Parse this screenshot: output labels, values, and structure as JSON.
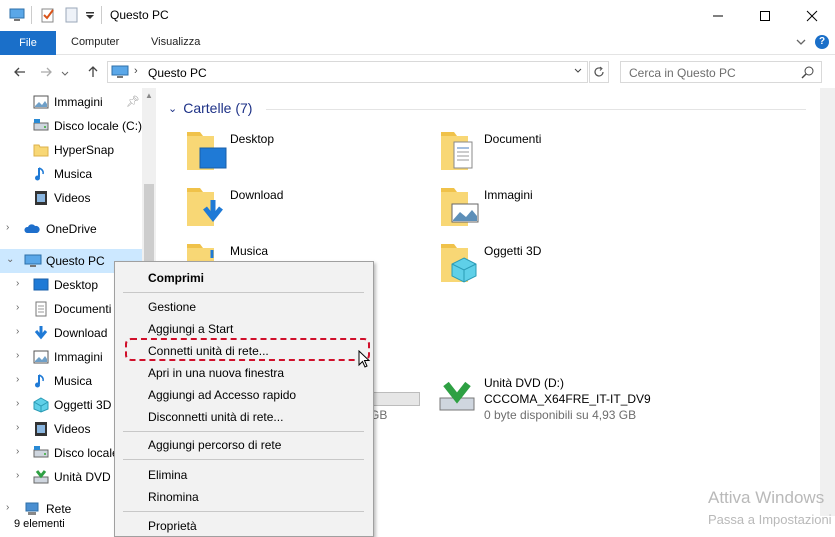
{
  "window": {
    "title": "Questo PC"
  },
  "ribbon": {
    "tabs": [
      "File",
      "Computer",
      "Visualizza"
    ]
  },
  "address": {
    "crumb": "Questo PC",
    "search_placeholder": "Cerca in Questo PC"
  },
  "sidebar": {
    "quick_access": [
      {
        "label": "Immagini",
        "icon": "pictures-icon",
        "pinned": true
      },
      {
        "label": "Disco locale (C:)",
        "icon": "drive-icon"
      },
      {
        "label": "HyperSnap",
        "icon": "folder-icon"
      },
      {
        "label": "Musica",
        "icon": "music-icon"
      },
      {
        "label": "Videos",
        "icon": "video-icon"
      }
    ],
    "onedrive": "OneDrive",
    "this_pc": "Questo PC",
    "pc_children": [
      {
        "label": "Desktop",
        "icon": "desktop-icon"
      },
      {
        "label": "Documenti",
        "icon": "documents-icon"
      },
      {
        "label": "Download",
        "icon": "download-icon"
      },
      {
        "label": "Immagini",
        "icon": "pictures-icon"
      },
      {
        "label": "Musica",
        "icon": "music-icon"
      },
      {
        "label": "Oggetti 3D",
        "icon": "3d-objects-icon"
      },
      {
        "label": "Videos",
        "icon": "video-icon"
      },
      {
        "label": "Disco locale",
        "icon": "drive-icon"
      },
      {
        "label": "Unità DVD",
        "icon": "dvd-icon"
      }
    ],
    "network": "Rete"
  },
  "main": {
    "group_title": "Cartelle (7)",
    "folders": [
      {
        "label": "Desktop",
        "icon": "desktop-folder-icon"
      },
      {
        "label": "Documenti",
        "icon": "documents-folder-icon"
      },
      {
        "label": "Download",
        "icon": "download-folder-icon"
      },
      {
        "label": "Immagini",
        "icon": "pictures-folder-icon"
      },
      {
        "label": "Musica",
        "icon": "music-folder-icon"
      },
      {
        "label": "Oggetti 3D",
        "icon": "3d-objects-folder-icon"
      }
    ],
    "drive_c": {
      "partial_text": "GB",
      "used_fraction": 0.5
    },
    "dvd": {
      "name": "Unità DVD (D:)",
      "label": "CCCOMA_X64FRE_IT-IT_DV9",
      "free": "0 byte disponibili su 4,93 GB"
    }
  },
  "status": {
    "items": "9 elementi"
  },
  "watermark": {
    "line1": "Attiva Windows",
    "line2": "Passa a Impostazioni"
  },
  "context_menu": {
    "items": [
      "Comprimi",
      "Gestione",
      "Aggiungi a Start",
      "Connetti unità di rete...",
      "Apri in una nuova finestra",
      "Aggiungi ad Accesso rapido",
      "Disconnetti unità di rete...",
      "Aggiungi percorso di rete",
      "Elimina",
      "Rinomina",
      "Proprietà"
    ]
  },
  "colors": {
    "accent": "#1a6fc9",
    "selection": "#cce8ff",
    "highlight": "#d0102b",
    "group_title": "#1e3287"
  }
}
